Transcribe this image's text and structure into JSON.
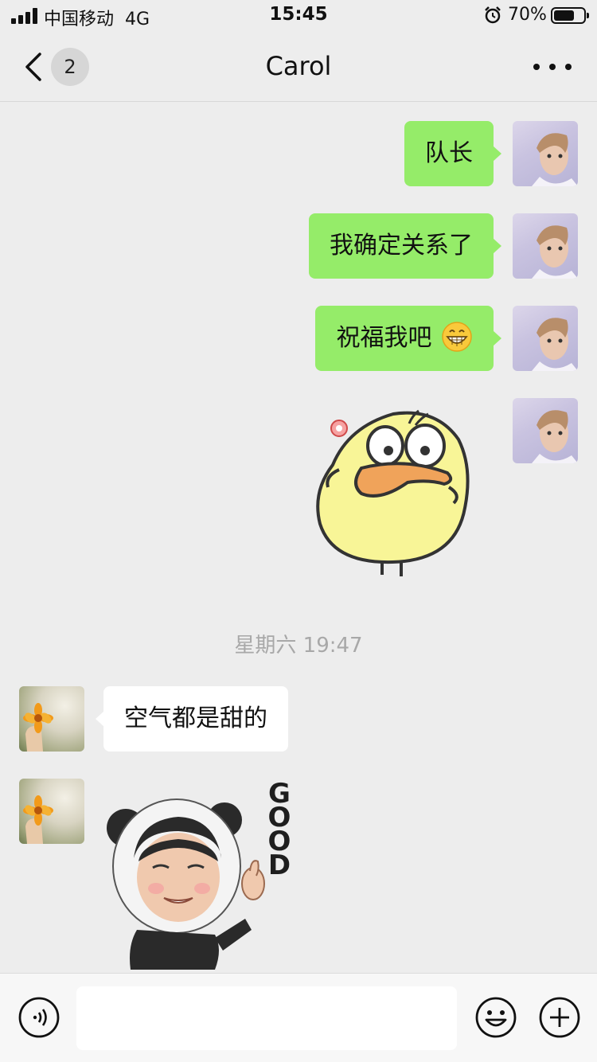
{
  "status_bar": {
    "carrier": "中国移动",
    "network": "4G",
    "time": "15:45",
    "battery_percent": "70%",
    "battery_level": 0.7
  },
  "nav": {
    "back_icon": "chevron-left-icon",
    "unread_count": "2",
    "title": "Carol",
    "more_icon": "ellipsis-icon"
  },
  "messages_sent": [
    {
      "text": "队长"
    },
    {
      "text": "我确定关系了"
    },
    {
      "text": "祝福我吧",
      "emoji": "grinning-face-icon"
    }
  ],
  "timestamp": "星期六 19:47",
  "messages_received": [
    {
      "text": "空气都是甜的"
    }
  ],
  "sticker_panda": {
    "caption": "GOOD"
  },
  "input_bar": {
    "voice_icon": "voice-icon",
    "input_value": "",
    "emoji_icon": "smiley-icon",
    "plus_icon": "plus-circle-icon"
  },
  "colors": {
    "background": "#ededed",
    "sent_bubble": "#95ec69",
    "received_bubble": "#ffffff",
    "timestamp": "#a8a8a8"
  }
}
